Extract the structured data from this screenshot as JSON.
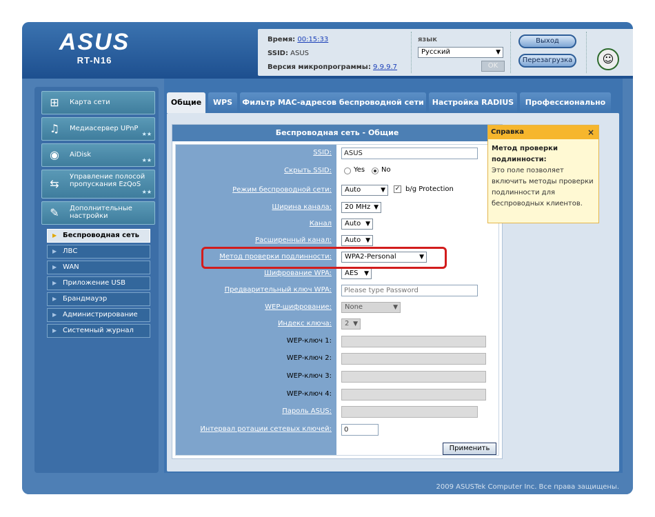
{
  "header": {
    "brand": "ASUS",
    "model": "RT-N16",
    "time_label": "Время:",
    "time_value": "00:15:33",
    "ssid_label": "SSID:",
    "ssid_value": "ASUS",
    "firmware_label": "Версия микропрограммы:",
    "firmware_value": "9.9.9.7",
    "language_label": "язык",
    "language_value": "Русский",
    "ok_label": "OK",
    "logout_label": "Выход",
    "reboot_label": "Перезагрузка"
  },
  "sidebar": {
    "items": [
      {
        "label": "Карта сети",
        "icon": "network-map-icon"
      },
      {
        "label": "Медиасервер UPnP",
        "icon": "media-server-icon"
      },
      {
        "label": "AiDisk",
        "icon": "aidisk-icon"
      },
      {
        "label": "Управление полосой пропускания EzQoS",
        "icon": "qos-icon"
      },
      {
        "label": "Дополнительные настройки",
        "icon": "advanced-settings-icon"
      }
    ],
    "sub_items": [
      {
        "label": "Беспроводная сеть",
        "active": true
      },
      {
        "label": "ЛВС",
        "active": false
      },
      {
        "label": "WAN",
        "active": false
      },
      {
        "label": "Приложение USB",
        "active": false
      },
      {
        "label": "Брандмауэр",
        "active": false
      },
      {
        "label": "Администрирование",
        "active": false
      },
      {
        "label": "Системный журнал",
        "active": false
      }
    ]
  },
  "tabs": [
    {
      "label": "Общие",
      "active": true
    },
    {
      "label": "WPS",
      "active": false
    },
    {
      "label": "Фильтр MAC-адресов беспроводной сети",
      "active": false
    },
    {
      "label": "Настройка RADIUS",
      "active": false
    },
    {
      "label": "Профессионально",
      "active": false
    }
  ],
  "panel": {
    "title": "Беспроводная сеть - Общие",
    "ssid_label": "SSID:",
    "ssid_value": "ASUS",
    "hide_ssid_label": "Скрыть SSID:",
    "hide_yes": "Yes",
    "hide_no": "No",
    "hide_selected": "No",
    "mode_label": "Режим беспроводной сети:",
    "mode_value": "Auto",
    "bg_protection_label": "b/g Protection",
    "bg_protection_checked": true,
    "width_label": "Ширина канала:",
    "width_value": "20 MHz",
    "channel_label": "Канал",
    "channel_value": "Auto",
    "ext_channel_label": "Расширенный канал:",
    "ext_channel_value": "Auto",
    "auth_label": "Метод проверки подлинности:",
    "auth_value": "WPA2-Personal",
    "wpa_enc_label": "Шифрование WPA:",
    "wpa_enc_value": "AES",
    "psk_label": "Предварительный ключ WPA:",
    "psk_placeholder": "Please type Password",
    "wep_enc_label": "WEP-шифрование:",
    "wep_enc_value": "None",
    "key_index_label": "Индекс ключа:",
    "key_index_value": "2",
    "wep1_label": "WEP-ключ 1:",
    "wep2_label": "WEP-ключ 2:",
    "wep3_label": "WEP-ключ 3:",
    "wep4_label": "WEP-ключ 4:",
    "asus_pass_label": "Пароль ASUS:",
    "rotation_label": "Интервал ротации сетевых ключей:",
    "rotation_value": "0",
    "apply_label": "Применить"
  },
  "help": {
    "header": "Справка",
    "close": "×",
    "title": "Метод проверки подлинности:",
    "body": "Это поле позволяет включить методы проверки подлинности для беспроводных клиентов."
  },
  "footer": {
    "copyright": "2009 ASUSTek Computer Inc. Все права защищены."
  },
  "colors": {
    "highlight": "#d21c1c",
    "frame": "#4e7fb5",
    "help_header": "#f6b62d"
  }
}
